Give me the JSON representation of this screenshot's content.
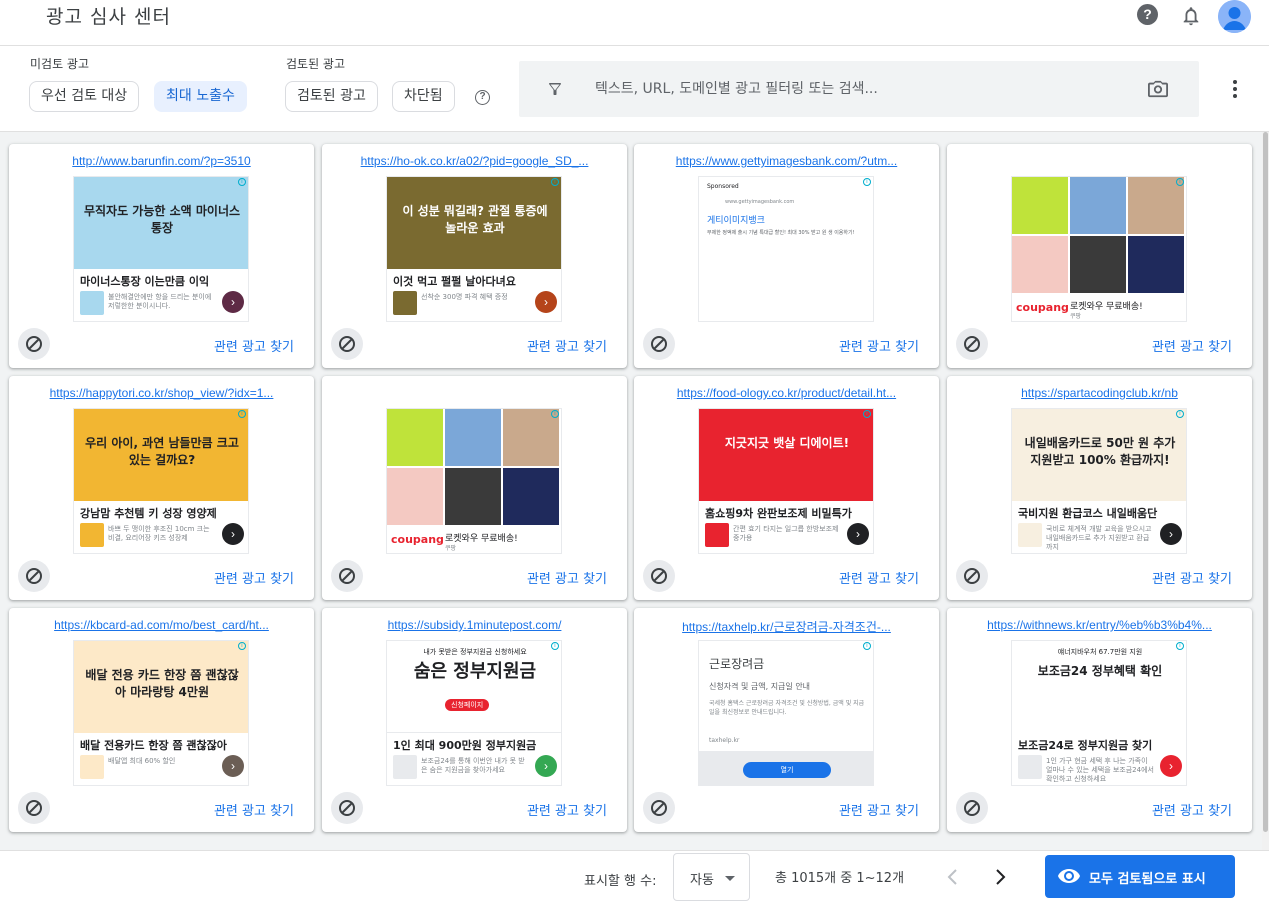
{
  "app": {
    "title": "광고 심사 센터"
  },
  "header": {
    "help_icon": "help-icon",
    "notifications_icon": "bell-icon",
    "avatar_icon": "account-avatar-icon"
  },
  "filters": {
    "unreviewed_label": "미검토 광고",
    "chip_priority": "우선 검토 대상",
    "chip_impressions": "최대 노출수",
    "reviewed_label": "검토된 광고",
    "chip_reviewed": "검토된 광고",
    "chip_blocked": "차단됨",
    "search_placeholder": "텍스트, URL, 도메인별 광고 필터링 또는 검색..."
  },
  "card_action": "관련 광고 찾기",
  "cards": [
    {
      "url": "http://www.barunfin.com/?p=3510",
      "headline": "무직자도 가능한 소액 마이너스통장",
      "title": "마이너스통장 이는만큼 이익",
      "small": "불안해결안에만 항을 드리는 분이에 저렇한한 분이시니다.",
      "accent": "#a8d8ee",
      "arrow": "#5e2a45"
    },
    {
      "url": "https://ho-ok.co.kr/a02/?pid=google_SD_...",
      "headline": "이 성분 뭐길래? 관절 통증에 놀라운 효과",
      "title": "이것 먹고 펄펄 날아다녀요",
      "small": "선착순 300명 파격 혜택 증정",
      "accent": "#7a6a30",
      "arrow": "#b5441a"
    },
    {
      "url": "https://www.gettyimagesbank.com/?utm...",
      "sponsor": "Sponsored",
      "domain": "www.gettyimagesbank.com",
      "headline": "게티이미지뱅크",
      "small": "무제한 정액제 출시 기념 특대급 할인! 최대 30% 받고 원 생 이용하기!",
      "accent": "#ffffff",
      "arrow": ""
    },
    {
      "url": "",
      "brand": "coupang",
      "title": "로켓와우 무료배송!",
      "small": "쿠팡",
      "accent": "#ffffff",
      "arrow": ""
    },
    {
      "url": "https://happytori.co.kr/shop_view/?idx=1...",
      "headline": "우리 아이, 과연 남들만큼 크고 있는 걸까요?",
      "title": "강남맘 추천템 키 성장 영양제",
      "small": "바쁘 두 맹이한 후조진 10cm 크는 비결, 요리어장 키즈 성장제",
      "accent": "#f2b632",
      "arrow": "#202124"
    },
    {
      "url": "",
      "brand": "coupang",
      "title": "로켓와우 무료배송!",
      "small": "쿠팡",
      "accent": "#ffffff",
      "arrow": ""
    },
    {
      "url": "https://food-ology.co.kr/product/detail.ht...",
      "headline": "지긋지긋 뱃살 디에이트!",
      "title": "홈쇼핑9차 완판보조제 비밀특가",
      "small": "간편 효기 타지는 일그릅 한방보조제 중가용",
      "accent": "#e8232f",
      "arrow": "#202124"
    },
    {
      "url": "https://spartacodingclub.kr/nb",
      "headline": "내일배움카드로 50만 원 추가 지원받고 100% 환급까지!",
      "title": "국비지원 환급코스 내일배움단",
      "small": "국비로 체계적 개발 교육을 받으시고 내일배움카드로 추가 지원받고 환급까지",
      "accent": "#f7efe0",
      "arrow": "#202124"
    },
    {
      "url": "https://kbcard-ad.com/mo/best_card/ht...",
      "headline": "배달 전용 카드 한장 쯤 괜찮잖아 마라랑탕 4만원",
      "title": "배달 전용카드 한장 쯤 괜찮잖아",
      "small": "배달앱 최대 60% 할인",
      "accent": "#fde9c8",
      "arrow": "#6b5e55"
    },
    {
      "url": "https://subsidy.1minutepost.com/",
      "headline": "숨은 정부지원금",
      "subhead": "내가 못받은 정부지원금 신청하세요",
      "badge": "신청페이지",
      "title": "1인 최대 900만원 정부지원금",
      "small": "보조금24를 통해 이번안 내가 못 받은 숨은 지원금을 찾아가세요",
      "accent": "#ffffff",
      "arrow": "#34a853"
    },
    {
      "url": "https://taxhelp.kr/근로장려금-자격조건-...",
      "headline": "근로장려금",
      "sub1": "신청자격 및 금액, 지급일 안내",
      "small": "국세청 홈택스 근로장려금 자격조건 및 신청방법, 금액 및 지급일을 최신정보로 안내드립니다.",
      "domain": "taxhelp.kr",
      "button": "열기",
      "accent": "#f8f9fa",
      "arrow": ""
    },
    {
      "url": "https://withnews.kr/entry/%eb%b3%b4%...",
      "headline": "보조금24 정부혜택 확인",
      "subhead": "얘너지바우처 67.7만원 지원",
      "title": "보조금24로 정부지원금 찾기",
      "small": "1인 가구 현금 세택 후 나는 가족이 얼마나 수 있는 세택을 보조금24에서 확인하고 신청하세요",
      "accent": "#ffffff",
      "arrow": "#e8232f"
    }
  ],
  "footer": {
    "rows_label": "표시할 행 수:",
    "rows_value": "자동",
    "range": "총 1015개 중 1~12개",
    "mark_all": "모두 검토됨으로 표시"
  }
}
